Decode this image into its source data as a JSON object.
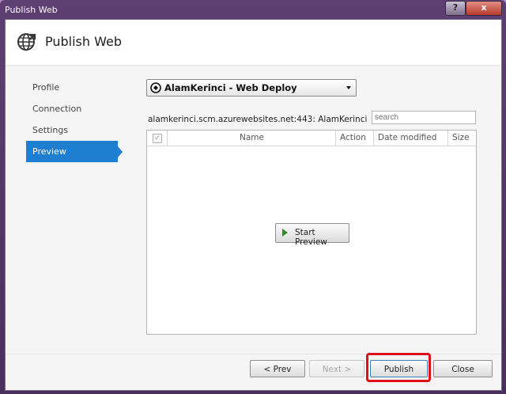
{
  "window": {
    "title": "Publish Web",
    "help_label": "?",
    "close_label": "x"
  },
  "header": {
    "title": "Publish Web",
    "icon": "globe-publish-icon"
  },
  "nav": {
    "items": [
      {
        "label": "Profile",
        "active": false
      },
      {
        "label": "Connection",
        "active": false
      },
      {
        "label": "Settings",
        "active": false
      },
      {
        "label": "Preview",
        "active": true
      }
    ],
    "accent": "#1e7fd0"
  },
  "profile": {
    "selected": "AlamKerinci - Web Deploy",
    "icon": "web-deploy-icon"
  },
  "site": {
    "address": "alamkerinci.scm.azurewebsites.net:443: AlamKerinci"
  },
  "search": {
    "placeholder": "search"
  },
  "grid": {
    "columns": [
      "Name",
      "Action",
      "Date modified",
      "Size"
    ],
    "select_all_checked": true,
    "rows": []
  },
  "preview": {
    "start_label": "Start Preview"
  },
  "footer": {
    "prev_label": "< Prev",
    "next_label": "Next >",
    "publish_label": "Publish",
    "close_label": "Close",
    "highlight_color": "#e0101b"
  }
}
